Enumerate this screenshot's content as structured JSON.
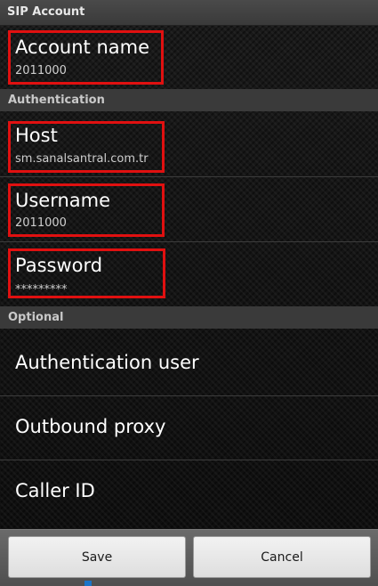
{
  "window": {
    "title": "SIP Account"
  },
  "account": {
    "name_title": "Account name",
    "name_value": "2011000"
  },
  "authentication": {
    "header": "Authentication",
    "host_title": "Host",
    "host_value": "sm.sanalsantral.com.tr",
    "username_title": "Username",
    "username_value": "2011000",
    "password_title": "Password",
    "password_value": "*********"
  },
  "optional": {
    "header": "Optional",
    "items": [
      {
        "label": "Authentication user"
      },
      {
        "label": "Outbound proxy"
      },
      {
        "label": "Caller ID"
      }
    ]
  },
  "buttons": {
    "save": "Save",
    "cancel": "Cancel"
  },
  "colors": {
    "highlight": "#e01010",
    "section_header_bg": "#3a3a3a",
    "text_primary": "#ffffff"
  }
}
